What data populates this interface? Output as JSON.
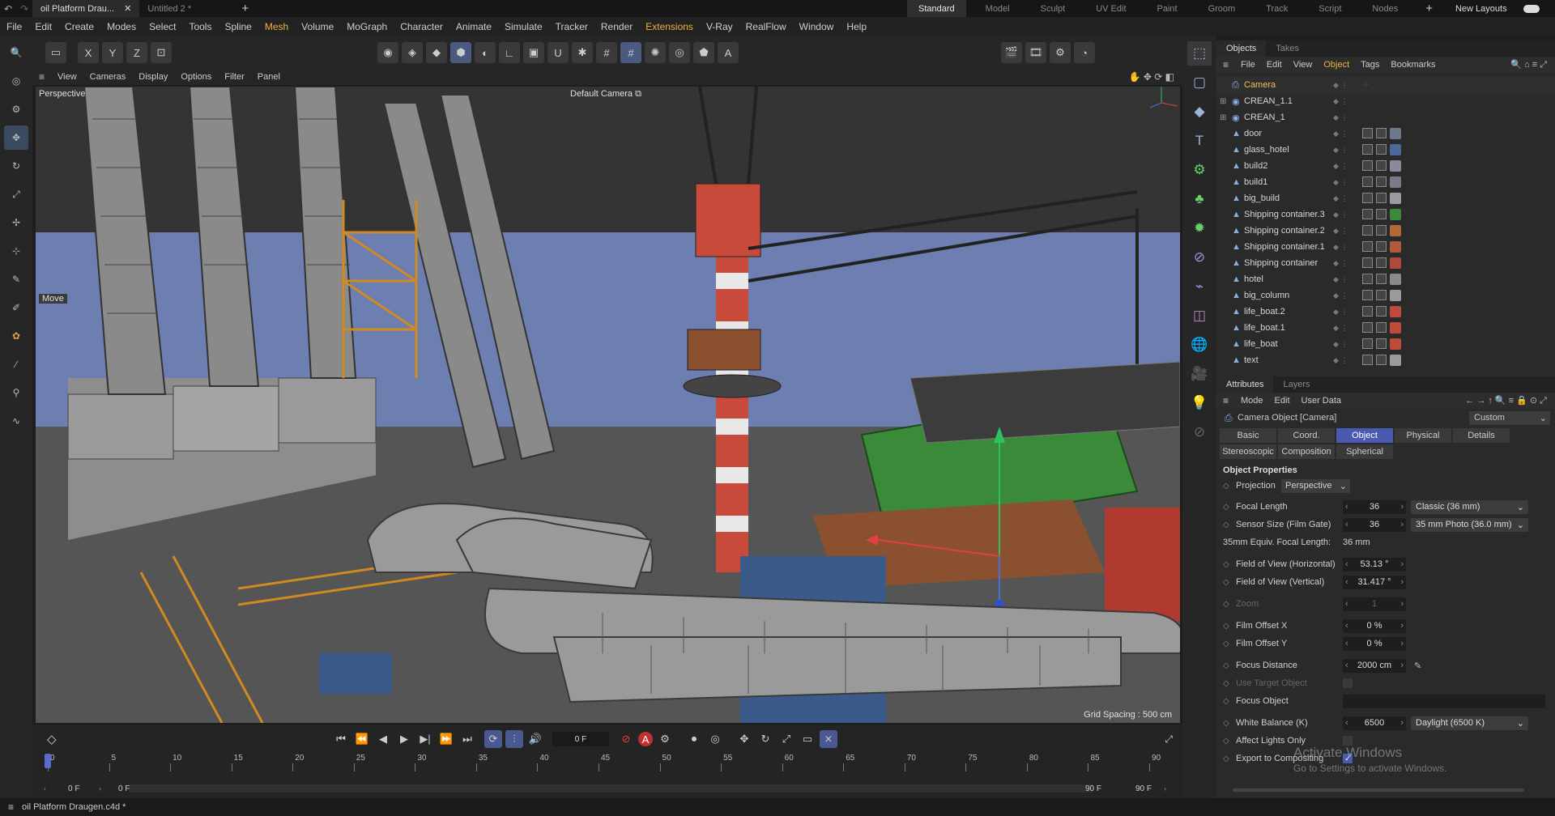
{
  "titlebar": {
    "tabs": [
      "oil Platform Drau...",
      "Untitled 2 *"
    ],
    "layouts": [
      "Standard",
      "Model",
      "Sculpt",
      "UV Edit",
      "Paint",
      "Groom",
      "Track",
      "Script",
      "Nodes"
    ],
    "new_layouts": "New Layouts"
  },
  "menubar": [
    "File",
    "Edit",
    "Create",
    "Modes",
    "Select",
    "Tools",
    "Spline",
    "Mesh",
    "Volume",
    "MoGraph",
    "Character",
    "Animate",
    "Simulate",
    "Tracker",
    "Render",
    "Extensions",
    "V-Ray",
    "RealFlow",
    "Window",
    "Help"
  ],
  "viewport_menu": [
    "View",
    "Cameras",
    "Display",
    "Options",
    "Filter",
    "Panel"
  ],
  "viewport": {
    "name": "Perspective",
    "camera": "Default Camera",
    "move_label": "Move",
    "grid_spacing": "Grid Spacing : 500 cm"
  },
  "timeline": {
    "current_frame": "0 F",
    "ticks": [
      "0",
      "5",
      "10",
      "15",
      "20",
      "25",
      "30",
      "35",
      "40",
      "45",
      "50",
      "55",
      "60",
      "65",
      "70",
      "75",
      "80",
      "85",
      "90"
    ],
    "start_field": "0 F",
    "start_field2": "0 F",
    "end_field": "90 F",
    "end_field2": "90 F",
    "playhead_frame": 0,
    "range_end_frame": 90
  },
  "statusbar": {
    "file": "oil Platform Draugen.c4d *"
  },
  "objects_panel": {
    "tabs": [
      "Objects",
      "Takes"
    ],
    "menu": [
      "File",
      "Edit",
      "View",
      "Object",
      "Tags",
      "Bookmarks"
    ],
    "items": [
      {
        "name": "Camera",
        "icon": "camera-icon",
        "highlight": true
      },
      {
        "name": "CREAN_1.1",
        "icon": "null-icon"
      },
      {
        "name": "CREAN_1",
        "icon": "null-icon"
      },
      {
        "name": "door",
        "icon": "polygon-icon",
        "mat": "#6a7a8a"
      },
      {
        "name": "glass_hotel",
        "icon": "polygon-icon",
        "mat": "#4a6a9a"
      },
      {
        "name": "build2",
        "icon": "polygon-icon",
        "mat": "#8a8a9a"
      },
      {
        "name": "build1",
        "icon": "polygon-icon",
        "mat": "#7a7a8a"
      },
      {
        "name": "big_build",
        "icon": "polygon-icon",
        "mat": "#9a9aa5"
      },
      {
        "name": "Shipping container.3",
        "icon": "polygon-icon",
        "mat": "#3a8a3a"
      },
      {
        "name": "Shipping container.2",
        "icon": "polygon-icon",
        "mat": "#b06a3a"
      },
      {
        "name": "Shipping container.1",
        "icon": "polygon-icon",
        "mat": "#b05a3a"
      },
      {
        "name": "Shipping container",
        "icon": "polygon-icon",
        "mat": "#b04a3a"
      },
      {
        "name": "hotel",
        "icon": "polygon-icon",
        "mat": "#8a8a8a"
      },
      {
        "name": "big_column",
        "icon": "polygon-icon",
        "mat": "#9a9a9a"
      },
      {
        "name": "life_boat.2",
        "icon": "polygon-icon",
        "mat": "#c04a3a"
      },
      {
        "name": "life_boat.1",
        "icon": "polygon-icon",
        "mat": "#c04a3a"
      },
      {
        "name": "life_boat",
        "icon": "polygon-icon",
        "mat": "#c04a3a"
      },
      {
        "name": "text",
        "icon": "polygon-icon",
        "mat": "#9a9a9a"
      }
    ]
  },
  "attributes_panel": {
    "tabs": [
      "Attributes",
      "Layers"
    ],
    "menu": [
      "Mode",
      "Edit",
      "User Data"
    ],
    "object_title": "Camera Object [Camera]",
    "preset": "Custom",
    "tabs_row1": [
      "Basic",
      "Coord.",
      "Object",
      "Physical",
      "Details"
    ],
    "tabs_row2": [
      "Stereoscopic",
      "Composition",
      "Spherical"
    ],
    "section": "Object Properties",
    "projection_label": "Projection",
    "projection_value": "Perspective",
    "rows": [
      {
        "label": "Focal Length",
        "value": "36",
        "dropdown": "Classic (36 mm)"
      },
      {
        "label": "Sensor Size (Film Gate)",
        "value": "36",
        "dropdown": "35 mm Photo (36.0 mm)"
      },
      {
        "label": "35mm Equiv. Focal Length:",
        "value": "36 mm",
        "plain": true
      },
      {
        "label": "Field of View (Horizontal)",
        "value": "53.13 °"
      },
      {
        "label": "Field of View (Vertical)",
        "value": "31.417 °"
      },
      {
        "label": "Zoom",
        "value": "1",
        "disabled": true
      },
      {
        "label": "Film Offset X",
        "value": "0 %"
      },
      {
        "label": "Film Offset Y",
        "value": "0 %"
      },
      {
        "label": "Focus Distance",
        "value": "2000 cm"
      },
      {
        "label": "Use Target Object",
        "value": "",
        "disabled": true
      },
      {
        "label": "Focus Object",
        "value": ""
      },
      {
        "label": "White Balance (K)",
        "value": "6500",
        "dropdown": "Daylight (6500 K)"
      },
      {
        "label": "Affect Lights Only",
        "value": ""
      },
      {
        "label": "Export to Compositing",
        "value": ""
      }
    ]
  },
  "watermark": {
    "line1": "Activate Windows",
    "line2": "Go to Settings to activate Windows."
  },
  "colors": {
    "accent_blue": "#4a5ab0",
    "highlight_orange": "#f0b040",
    "sky": "#6c7fb0"
  }
}
